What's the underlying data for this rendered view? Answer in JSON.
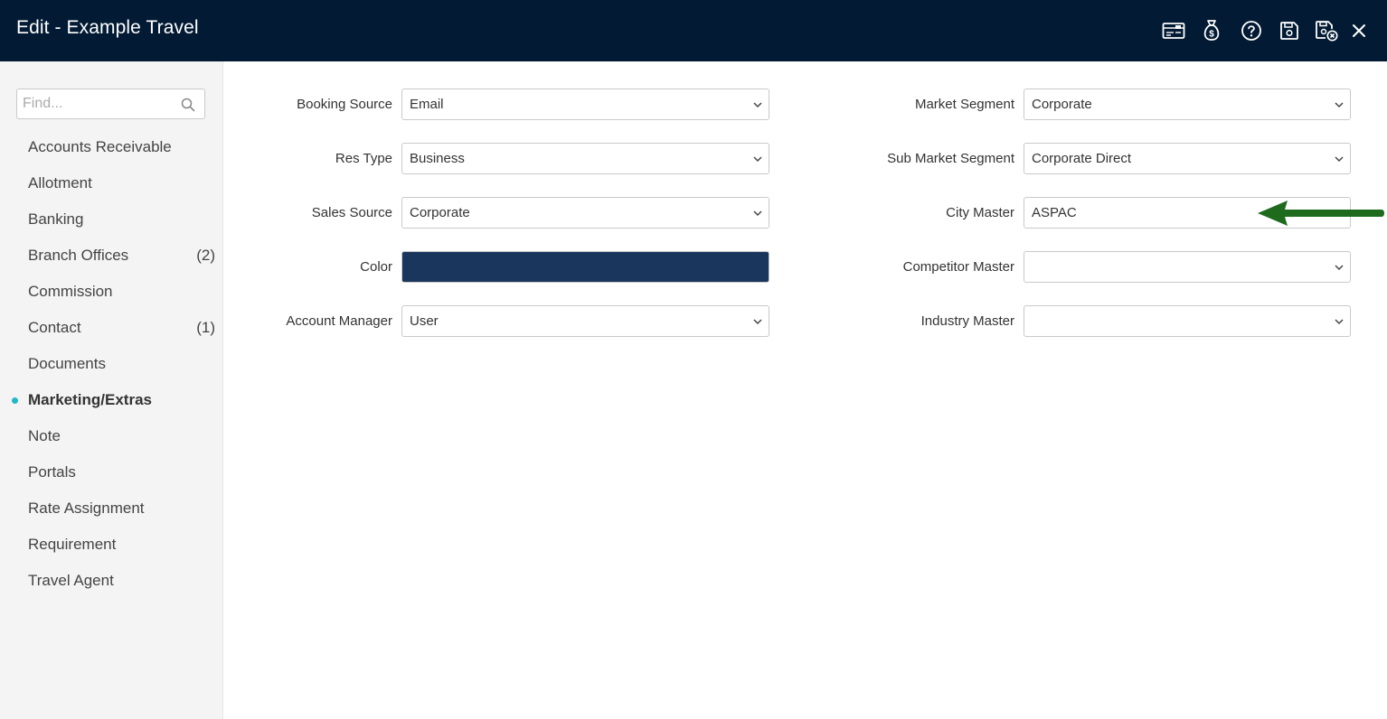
{
  "window": {
    "title": "Edit - Example Travel"
  },
  "toolbar": {
    "icons": [
      "card-icon",
      "money-bag-icon",
      "help-icon",
      "save-icon",
      "save-close-icon",
      "close-icon"
    ]
  },
  "sidebar": {
    "search": {
      "placeholder": "Find...",
      "value": ""
    },
    "items": [
      {
        "label": "Accounts Receivable",
        "count": ""
      },
      {
        "label": "Allotment",
        "count": ""
      },
      {
        "label": "Banking",
        "count": ""
      },
      {
        "label": "Branch Offices",
        "count": "(2)"
      },
      {
        "label": "Commission",
        "count": ""
      },
      {
        "label": "Contact",
        "count": "(1)"
      },
      {
        "label": "Documents",
        "count": ""
      },
      {
        "label": "Marketing/Extras",
        "count": "",
        "active": true
      },
      {
        "label": "Note",
        "count": ""
      },
      {
        "label": "Portals",
        "count": ""
      },
      {
        "label": "Rate Assignment",
        "count": ""
      },
      {
        "label": "Requirement",
        "count": ""
      },
      {
        "label": "Travel Agent",
        "count": ""
      }
    ]
  },
  "form": {
    "booking_source": {
      "label": "Booking Source",
      "value": "Email"
    },
    "res_type": {
      "label": "Res Type",
      "value": "Business"
    },
    "sales_source": {
      "label": "Sales Source",
      "value": "Corporate"
    },
    "color": {
      "label": "Color",
      "value": "#1a365d"
    },
    "account_manager": {
      "label": "Account Manager",
      "value": "User"
    },
    "market_segment": {
      "label": "Market Segment",
      "value": "Corporate"
    },
    "sub_market_segment": {
      "label": "Sub Market Segment",
      "value": "Corporate Direct"
    },
    "city_master": {
      "label": "City Master",
      "value": "ASPAC"
    },
    "competitor_master": {
      "label": "Competitor Master",
      "value": ""
    },
    "industry_master": {
      "label": "Industry Master",
      "value": ""
    }
  },
  "colors": {
    "header_bg": "#021a33",
    "accent_dot": "#21b8c7",
    "annotation_arrow": "#1e6b1e"
  }
}
